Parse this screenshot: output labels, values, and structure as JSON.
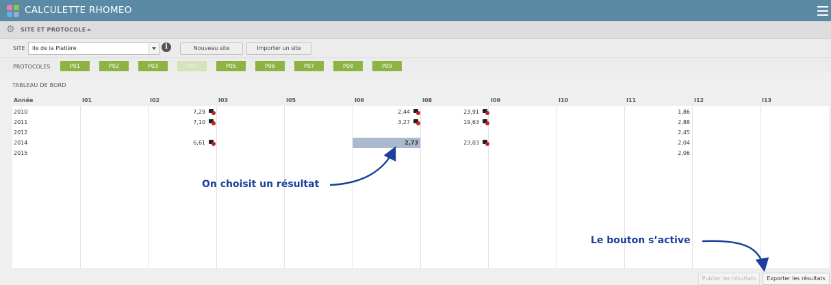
{
  "app": {
    "title": "CALCULETTE RHOMEO"
  },
  "section": {
    "title": "SITE ET PROTOCOLE"
  },
  "site": {
    "label": "SITE",
    "selected": "Ile de la Platière",
    "new_button": "Nouveau site",
    "import_button": "Importer un site"
  },
  "protocols": {
    "label": "PROTOCOLES",
    "items": [
      {
        "label": "P01",
        "enabled": true
      },
      {
        "label": "P02",
        "enabled": true
      },
      {
        "label": "P03",
        "enabled": true
      },
      {
        "label": "P04",
        "enabled": false
      },
      {
        "label": "P05",
        "enabled": true
      },
      {
        "label": "P06",
        "enabled": true
      },
      {
        "label": "P07",
        "enabled": true
      },
      {
        "label": "P08",
        "enabled": true
      },
      {
        "label": "P09",
        "enabled": true
      }
    ]
  },
  "dashboard": {
    "title": "TABLEAU DE BORD",
    "columns": [
      "Année",
      "I01",
      "I02",
      "I03",
      "I05",
      "I06",
      "I08",
      "I09",
      "I10",
      "I11",
      "I12",
      "I13"
    ],
    "rows": [
      {
        "year": "2010",
        "I02": "7,29",
        "I06": "2,44",
        "I08": "23,91",
        "I11": "1,86"
      },
      {
        "year": "2011",
        "I02": "7,10",
        "I06": "3,27",
        "I08": "19,63",
        "I11": "2,88"
      },
      {
        "year": "2012",
        "I11": "2,45"
      },
      {
        "year": "2014",
        "I02": "6,61",
        "I06": "2,73",
        "I08": "23,03",
        "I11": "2,04"
      },
      {
        "year": "2015",
        "I11": "2,06"
      }
    ],
    "selected": {
      "year": "2014",
      "column": "I06"
    }
  },
  "annotations": {
    "choose": "On choisit un résultat",
    "activates": "Le bouton s’active"
  },
  "footer": {
    "publish_button": "Publier les résultats",
    "export_button": "Exporter les résultats"
  },
  "colors": {
    "header": "#5b8aa5",
    "protocol": "#8db443",
    "protocol_disabled": "#d6e3b9",
    "selected_cell": "#aab9cc",
    "annotation": "#1a3f9c"
  }
}
